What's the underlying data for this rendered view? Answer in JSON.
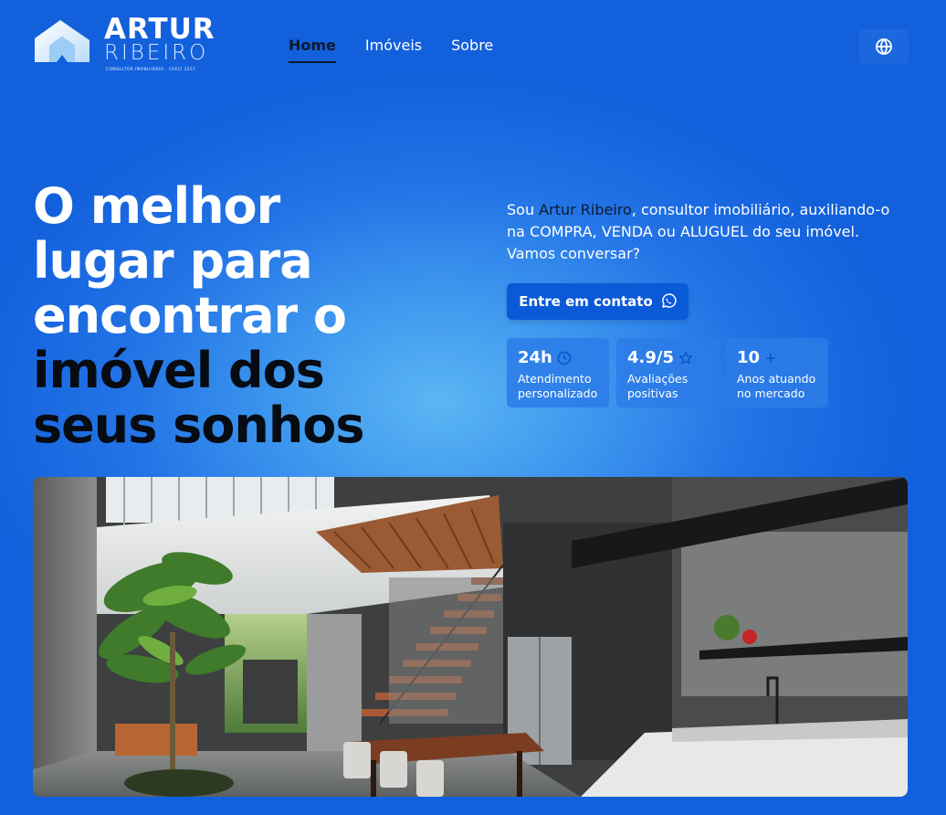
{
  "brand": {
    "name_line1": "ARTUR",
    "name_line2": "RIBEIRO",
    "tagline": "CONSULTOR IMOBILIÁRIO - CRECI 3257"
  },
  "nav": {
    "items": [
      {
        "label": "Home",
        "active": true
      },
      {
        "label": "Imóveis",
        "active": false
      },
      {
        "label": "Sobre",
        "active": false
      }
    ],
    "language_icon": "globe-icon"
  },
  "hero": {
    "headline_light": [
      "O melhor",
      "lugar para",
      "encontrar o"
    ],
    "headline_dark": [
      "imóvel dos",
      "seus sonhos"
    ],
    "intro_before": "Sou ",
    "intro_name": "Artur Ribeiro",
    "intro_after": ", consultor imobiliário, auxiliando-o na COMPRA, VENDA ou ALUGUEL do seu imóvel. Vamos conversar?",
    "cta_label": "Entre em contato",
    "cta_icon": "whatsapp-icon"
  },
  "stats": [
    {
      "value": "24h",
      "icon": "clock-icon",
      "label_line1": "Atendimento",
      "label_line2": "personalizado"
    },
    {
      "value": "4.9/5",
      "icon": "star-icon",
      "label_line1": "Avaliações",
      "label_line2": "positivas"
    },
    {
      "value": "10",
      "icon": "plus-icon",
      "label_line1": "Anos atuando",
      "label_line2": "no mercado"
    }
  ],
  "colors": {
    "accent_dark": "#070b12",
    "button_blue": "#0a5ad7",
    "icon_blue": "#0b55c9"
  }
}
